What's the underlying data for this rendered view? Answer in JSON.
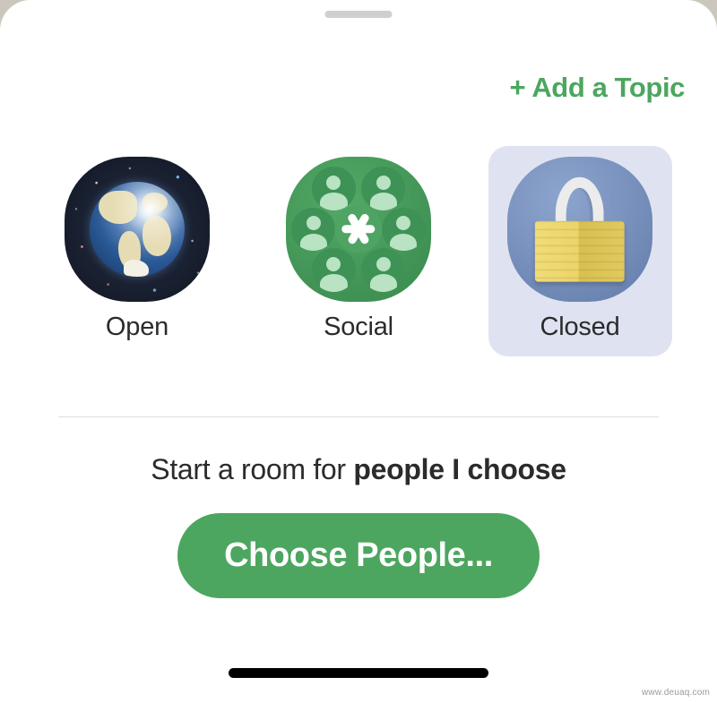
{
  "sheet": {
    "drag_handle": "drag-handle",
    "background_color": "#ffffff",
    "outside_color": "#cbc7bd"
  },
  "header": {
    "add_topic_label": "+ Add a Topic",
    "add_topic_color": "#4ca65f"
  },
  "options": {
    "selected_index": 2,
    "selected_bg_color": "#dfe3f1",
    "items": [
      {
        "id": "open",
        "label": "Open",
        "icon": "globe-icon",
        "selected": false
      },
      {
        "id": "social",
        "label": "Social",
        "icon": "people-ring-icon",
        "selected": false
      },
      {
        "id": "closed",
        "label": "Closed",
        "icon": "padlock-icon",
        "selected": true
      }
    ]
  },
  "start_room": {
    "prefix": "Start a room for ",
    "emphasis": "people I choose"
  },
  "cta": {
    "label": "Choose People...",
    "color": "#4ca65f"
  },
  "footer": {
    "watermark": "www.deuaq.com"
  }
}
